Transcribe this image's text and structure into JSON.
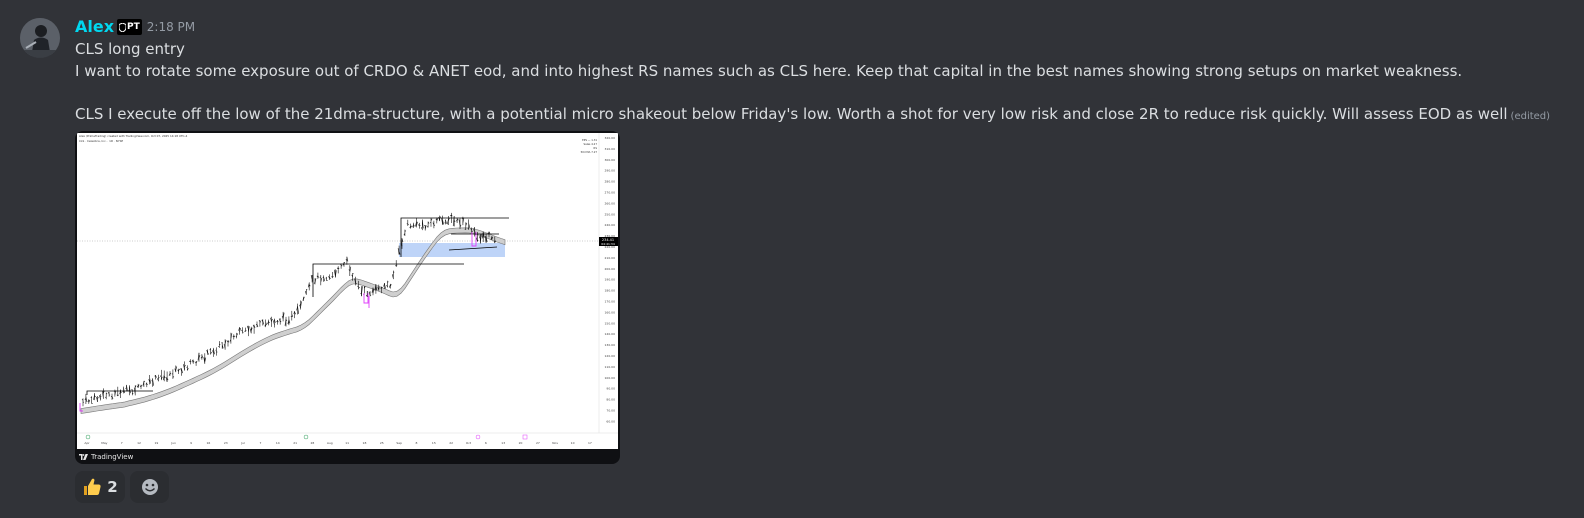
{
  "message": {
    "author": "Alex",
    "author_tag": "PT",
    "timestamp": "2:18 PM",
    "lines": [
      "CLS long entry",
      "I want to rotate some exposure out of CRDO & ANET eod, and into highest RS names such as CLS here. Keep that capital in the best names showing strong setups on market weakness.",
      "",
      "CLS I execute off the low of the 21dma-structure, with a potential micro shakeout below Friday's low. Worth a shot for very low risk and close 2R to reduce risk quickly. Will assess EOD as well"
    ],
    "edited_label": "(edited)"
  },
  "embed": {
    "chart_header": "CLS · Celestica, Inc. · 1D · NYSE",
    "chart_credit": "Alex (PrimeTrading) created with TradingView.com, Oct 07, 2025 14:18 UTC-4",
    "footer_label": "TradingView",
    "price_tag_top": "234.41",
    "price_tag_bottom": "04:41:34",
    "x_ticks": [
      "Apr",
      "May",
      "7",
      "12",
      "19",
      "Jun",
      "9",
      "16",
      "23",
      "Jul",
      "7",
      "14",
      "21",
      "28",
      "Aug",
      "11",
      "18",
      "25",
      "Sep",
      "8",
      "15",
      "22",
      "Oct",
      "6",
      "13",
      "20",
      "27",
      "Nov",
      "10",
      "17",
      "24"
    ],
    "y_ticks": [
      "320.00",
      "310.00",
      "300.00",
      "290.00",
      "280.00",
      "270.00",
      "260.00",
      "250.00",
      "240.00",
      "230.00",
      "220.00",
      "210.00",
      "200.00",
      "190.00",
      "180.00",
      "170.00",
      "160.00",
      "150.00",
      "140.00",
      "130.00",
      "120.00",
      "110.00",
      "100.00",
      "90.00",
      "80.00",
      "70.00",
      "60.00"
    ],
    "legend_rows": [
      "EPS — 1.31",
      "Sales 4.27",
      "RS",
      "50d MA 7.27"
    ]
  },
  "reactions": [
    {
      "icon": "thumbs-up-icon",
      "emoji": "👍",
      "count": "2"
    },
    {
      "icon": "add-reaction-icon",
      "emoji": "☺",
      "count": ""
    }
  ],
  "colors": {
    "background": "#313338",
    "username": "#00d8f0",
    "text": "#dbdee1",
    "muted": "#949ba4",
    "reaction_bg": "#2b2d31"
  }
}
